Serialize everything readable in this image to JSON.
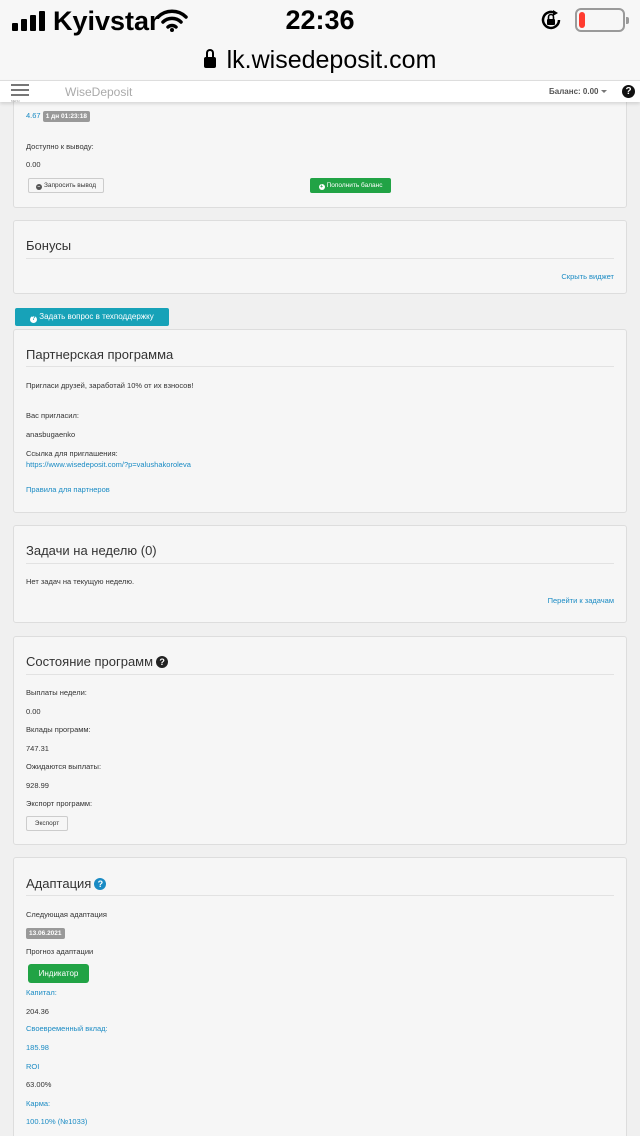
{
  "status_bar": {
    "carrier": "Kyivstar",
    "time": "22:36",
    "battery_level": 0.15,
    "battery_color": "#ff3b30"
  },
  "url_bar": {
    "url": "lk.wisedeposit.com",
    "icon": "lock-icon"
  },
  "navbar": {
    "menu_caption": "MENU",
    "brand": "WiseDeposit",
    "balance": "Баланс: 0.00",
    "help": "?"
  },
  "account": {
    "amount": "4.67",
    "timer": "1 дн 01:23:18",
    "available_label": "Доступно к выводу:",
    "available_value": "0.00",
    "withdraw_button": "Запросить вывод",
    "deposit_button": "Пополнить баланс"
  },
  "bonuses": {
    "title": "Бонусы",
    "hide_link": "Скрыть виджет"
  },
  "support_button": "Задать вопрос в техподдержку",
  "partner": {
    "title": "Партнерская программа",
    "invite_text": "Пригласи друзей, заработай 10% от их взносов!",
    "invited_by_label": "Вас пригласил:",
    "invited_by_value": "anasbugaenko",
    "ref_link_label": "Ссылка для приглашения:",
    "ref_link": "https://www.wisedeposit.com/?p=valushakoroleva",
    "rules_link": "Правила для партнеров"
  },
  "tasks": {
    "title": "Задачи на неделю (0)",
    "empty_text": "Нет задач на текущую неделю.",
    "goto_link": "Перейти к задачам"
  },
  "programs": {
    "title": "Состояние программ",
    "payouts_week_label": "Выплаты недели:",
    "payouts_week_value": "0.00",
    "deposits_label": "Вклады программ:",
    "deposits_value": "747.31",
    "expected_label": "Ожидаются выплаты:",
    "expected_value": "928.99",
    "export_label": "Экспорт программ:",
    "export_button": "Экспорт"
  },
  "adaptation": {
    "title": "Адаптация",
    "next_label": "Следующая адаптация",
    "next_date": "13.06.2021",
    "forecast_label": "Прогноз адаптации",
    "indicator_button": "Индикатор",
    "capital_label": "Капитал:",
    "capital_value": "204.36",
    "timely_label": "Своевременный вклад:",
    "timely_value": "185.98",
    "roi_label": "ROI",
    "roi_value": "63.00%",
    "karma_label": "Карма:",
    "karma_value": "100.10% (№1033)"
  },
  "colors": {
    "link": "#1a8bc4",
    "green": "#21a345",
    "teal": "#17a2b8",
    "badge": "#999999"
  }
}
